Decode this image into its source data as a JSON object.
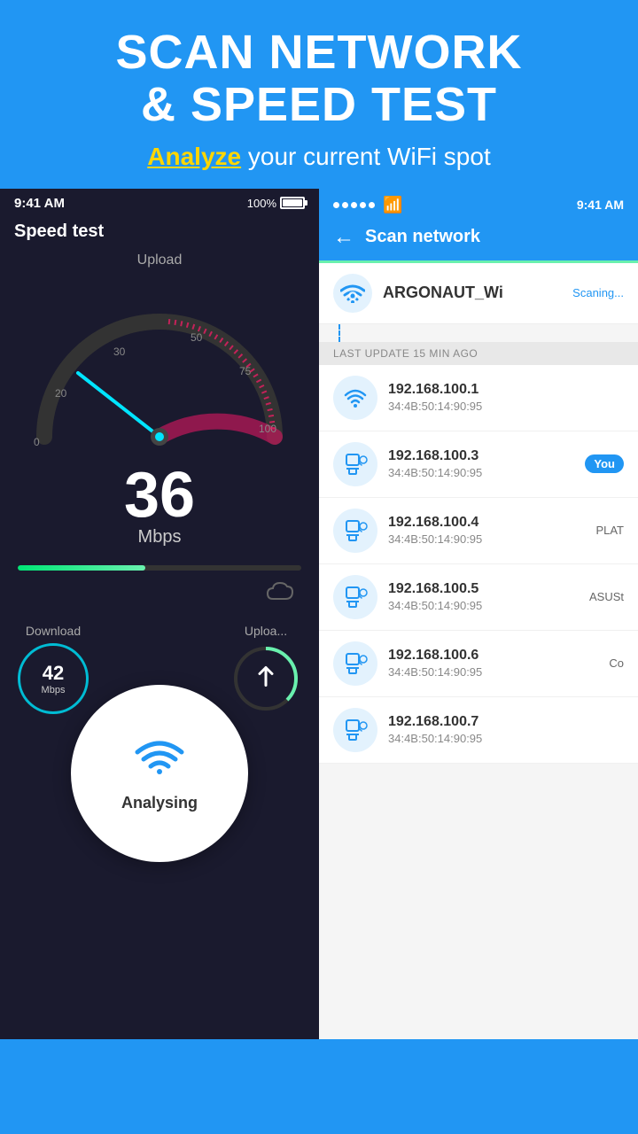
{
  "header": {
    "title_line1": "SCAN NETWORK",
    "title_line2": "& SPEED TEST",
    "subtitle_highlight": "Analyze",
    "subtitle_rest": " your current WiFi spot"
  },
  "left_phone": {
    "status_bar": {
      "time": "9:41 AM",
      "battery": "100%"
    },
    "title": "Speed test",
    "upload_label": "Upload",
    "speed_number": "36",
    "speed_unit": "Mbps",
    "download_label": "Download",
    "upload_stat_label": "Uploa...",
    "download_value": "42",
    "download_unit": "Mbps",
    "analysing_text": "Analysing"
  },
  "right_phone": {
    "status_bar": {
      "time": "9:41 AM"
    },
    "nav_title": "Scan network",
    "network_name": "ARGONAUT_Wi",
    "scanning_label": "Scaning...",
    "last_update": "LAST UPDATE 15 MIN AGO",
    "devices": [
      {
        "ip": "192.168.100.1",
        "mac": "34:4B:50:14:90:95",
        "type": "router",
        "badge": ""
      },
      {
        "ip": "192.168.100.3",
        "mac": "34:4B:50:14:90:95",
        "type": "computer",
        "badge": "You"
      },
      {
        "ip": "192.168.100.4",
        "mac": "34:4B:50:14:90:95",
        "type": "computer",
        "badge": "PLAT"
      },
      {
        "ip": "192.168.100.5",
        "mac": "34:4B:50:14:90:95",
        "type": "computer",
        "badge": "ASUSt"
      },
      {
        "ip": "192.168.100.6",
        "mac": "34:4B:50:14:90:95",
        "type": "computer",
        "badge": "Co"
      },
      {
        "ip": "192.168.100.7",
        "mac": "34:4B:50:14:90:95",
        "type": "computer",
        "badge": ""
      }
    ]
  },
  "colors": {
    "primary": "#2196F3",
    "accent_yellow": "#FFD600",
    "accent_green": "#69f0ae",
    "dark_bg": "#1a1a2e",
    "light_bg": "#f5f5f5"
  }
}
